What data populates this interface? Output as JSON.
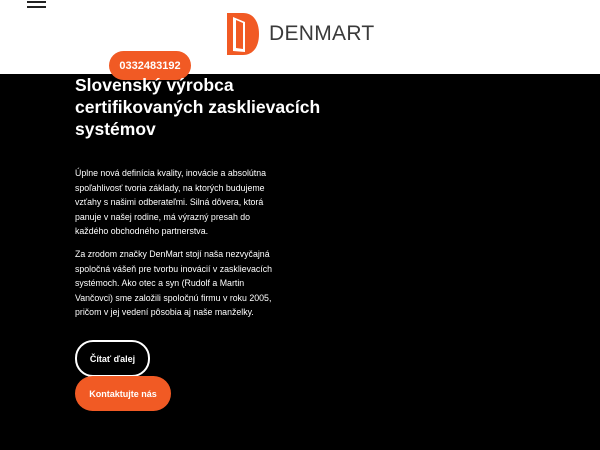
{
  "header": {
    "menu_icon": "hamburger-menu-icon",
    "logo_icon": "door-logo-icon",
    "logo_text": "DENMART",
    "phone_label": "0332483192"
  },
  "hero": {
    "headline": "Slovenský výrobca certifikovaných zasklievacích systémov",
    "paragraph_1": "Úplne nová definícia kvality, inovácie a absolútna spoľahlivosť tvoria základy, na ktorých budujeme vzťahy s našimi odberateľmi. Silná dôvera, ktorá panuje v našej rodine, má výrazný presah do každého obchodného partnerstva.",
    "paragraph_2": "Za zrodom značky DenMart stojí naša nezvyčajná spoločná vášeň pre tvorbu inovácií v zasklievacích systémoch. Ako otec a syn (Rudolf a Martin Vančovci) sme založili spoločnú firmu v roku 2005, pričom v jej vedení pôsobia aj naše manželky.",
    "read_more_label": "Čítať ďalej",
    "contact_label": "Kontaktujte nás"
  },
  "colors": {
    "accent": "#f15a24",
    "background": "#000000",
    "header_background": "#ffffff"
  }
}
